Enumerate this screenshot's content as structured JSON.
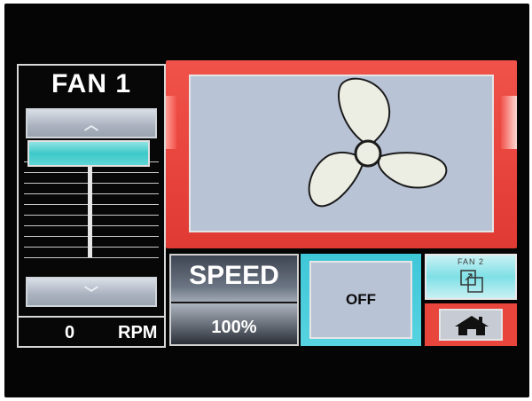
{
  "panel": {
    "title": "FAN 1",
    "up_arrow": "︿",
    "down_arrow": "﹀",
    "rpm_value": "0",
    "rpm_unit": "RPM",
    "slider_level_fraction": 1.0
  },
  "speed": {
    "label": "SPEED",
    "value": "100%"
  },
  "off_button": {
    "label": "OFF"
  },
  "fan2_button": {
    "label": "FAN 2",
    "icon": "window-switch-icon"
  },
  "home_button": {
    "icon": "home-icon"
  },
  "fan_graphic": {
    "icon": "fan-propeller-icon"
  },
  "colors": {
    "frame_red": "#e8453d",
    "accent_cyan": "#3ec7d8",
    "window_gray_blue": "#b9c3d6",
    "background": "#050505"
  }
}
